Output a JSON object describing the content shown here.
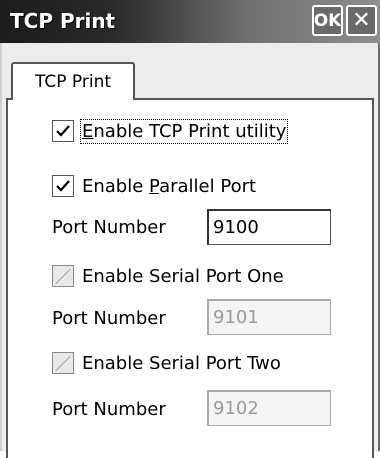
{
  "window": {
    "title": "TCP Print",
    "ok_label": "OK",
    "close_label": "✕"
  },
  "tabs": [
    {
      "label": "TCP Print",
      "active": true
    }
  ],
  "form": {
    "enable_utility": {
      "pre": "",
      "mnemonic": "E",
      "post": "nable TCP Print utility",
      "checked": true
    },
    "parallel": {
      "label_pre": "Enable ",
      "mnemonic": "P",
      "label_post": "arallel Port",
      "checked": true,
      "port_label": "Port Number",
      "port_value": "9100",
      "enabled": true
    },
    "serial_one": {
      "label": "Enable Serial Port One",
      "checked": false,
      "port_label": "Port Number",
      "port_value": "9101",
      "enabled": false
    },
    "serial_two": {
      "label": "Enable Serial Port Two",
      "checked": false,
      "port_label": "Port Number",
      "port_value": "9102",
      "enabled": false
    }
  }
}
